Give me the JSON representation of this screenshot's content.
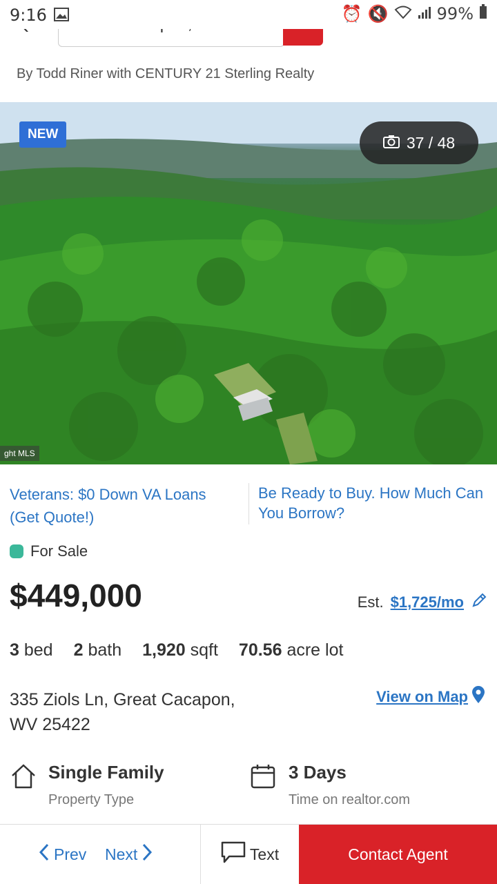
{
  "status_bar": {
    "time": "9:16",
    "battery": "99%"
  },
  "search": {
    "query": "Great Cacapon, WV"
  },
  "byline": "By Todd Riner with CENTURY 21 Sterling Realty",
  "photo": {
    "badge": "NEW",
    "counter": "37 / 48",
    "watermark": "ght MLS"
  },
  "promos": {
    "left": "Veterans: $0 Down VA Loans (Get Quote!)",
    "right": "Be Ready to Buy. How Much Can You Borrow?"
  },
  "listing": {
    "status": "For Sale",
    "price": "$449,000",
    "est_label": "Est.",
    "est_value": "$1,725/mo",
    "beds_num": "3",
    "beds_label": "bed",
    "baths_num": "2",
    "baths_label": "bath",
    "sqft_num": "1,920",
    "sqft_label": "sqft",
    "lot_num": "70.56",
    "lot_label": "acre lot",
    "address_line1": "335 Ziols Ln, Great Cacapon,",
    "address_line2": "WV 25422",
    "view_map": "View on Map",
    "property_type": "Single Family",
    "property_type_label": "Property Type",
    "time_on_site": "3 Days",
    "time_on_site_label": "Time on realtor.com"
  },
  "bottom_bar": {
    "prev": "Prev",
    "next": "Next",
    "text": "Text",
    "contact": "Contact Agent"
  },
  "colors": {
    "brand_red": "#d92228",
    "link_blue": "#2b75c4",
    "status_green": "#3bb89a",
    "new_badge": "#2f6fd6"
  }
}
